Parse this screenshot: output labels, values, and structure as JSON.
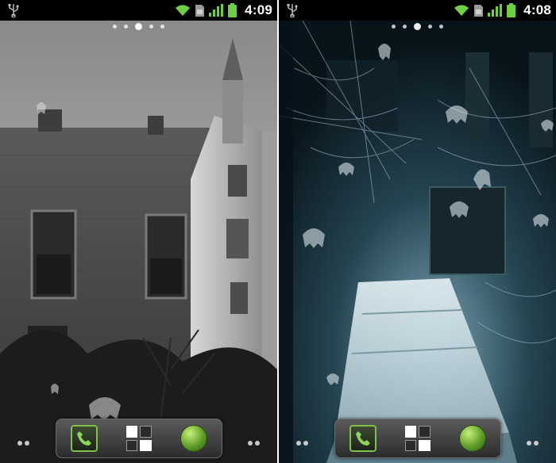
{
  "screens": [
    {
      "status": {
        "time": "4:09",
        "icons": [
          "usb-icon",
          "wifi-icon",
          "sim-icon",
          "signal-icon",
          "battery-icon"
        ]
      },
      "wallpaper": "haunted-castle",
      "page_indicator": {
        "count": 5,
        "active": 2
      },
      "dock": {
        "buttons": [
          "phone-icon",
          "launcher-icon",
          "browser-icon"
        ]
      },
      "colors": {
        "status_icons": "#6cd040",
        "accent": "#7fc04a"
      }
    },
    {
      "status": {
        "time": "4:08",
        "icons": [
          "usb-icon",
          "wifi-icon",
          "sim-icon",
          "signal-icon",
          "battery-icon"
        ]
      },
      "wallpaper": "haunted-lab",
      "page_indicator": {
        "count": 5,
        "active": 2
      },
      "dock": {
        "buttons": [
          "phone-icon",
          "launcher-icon",
          "browser-icon"
        ]
      },
      "colors": {
        "status_icons": "#6cd040",
        "accent": "#7fc04a"
      }
    }
  ]
}
